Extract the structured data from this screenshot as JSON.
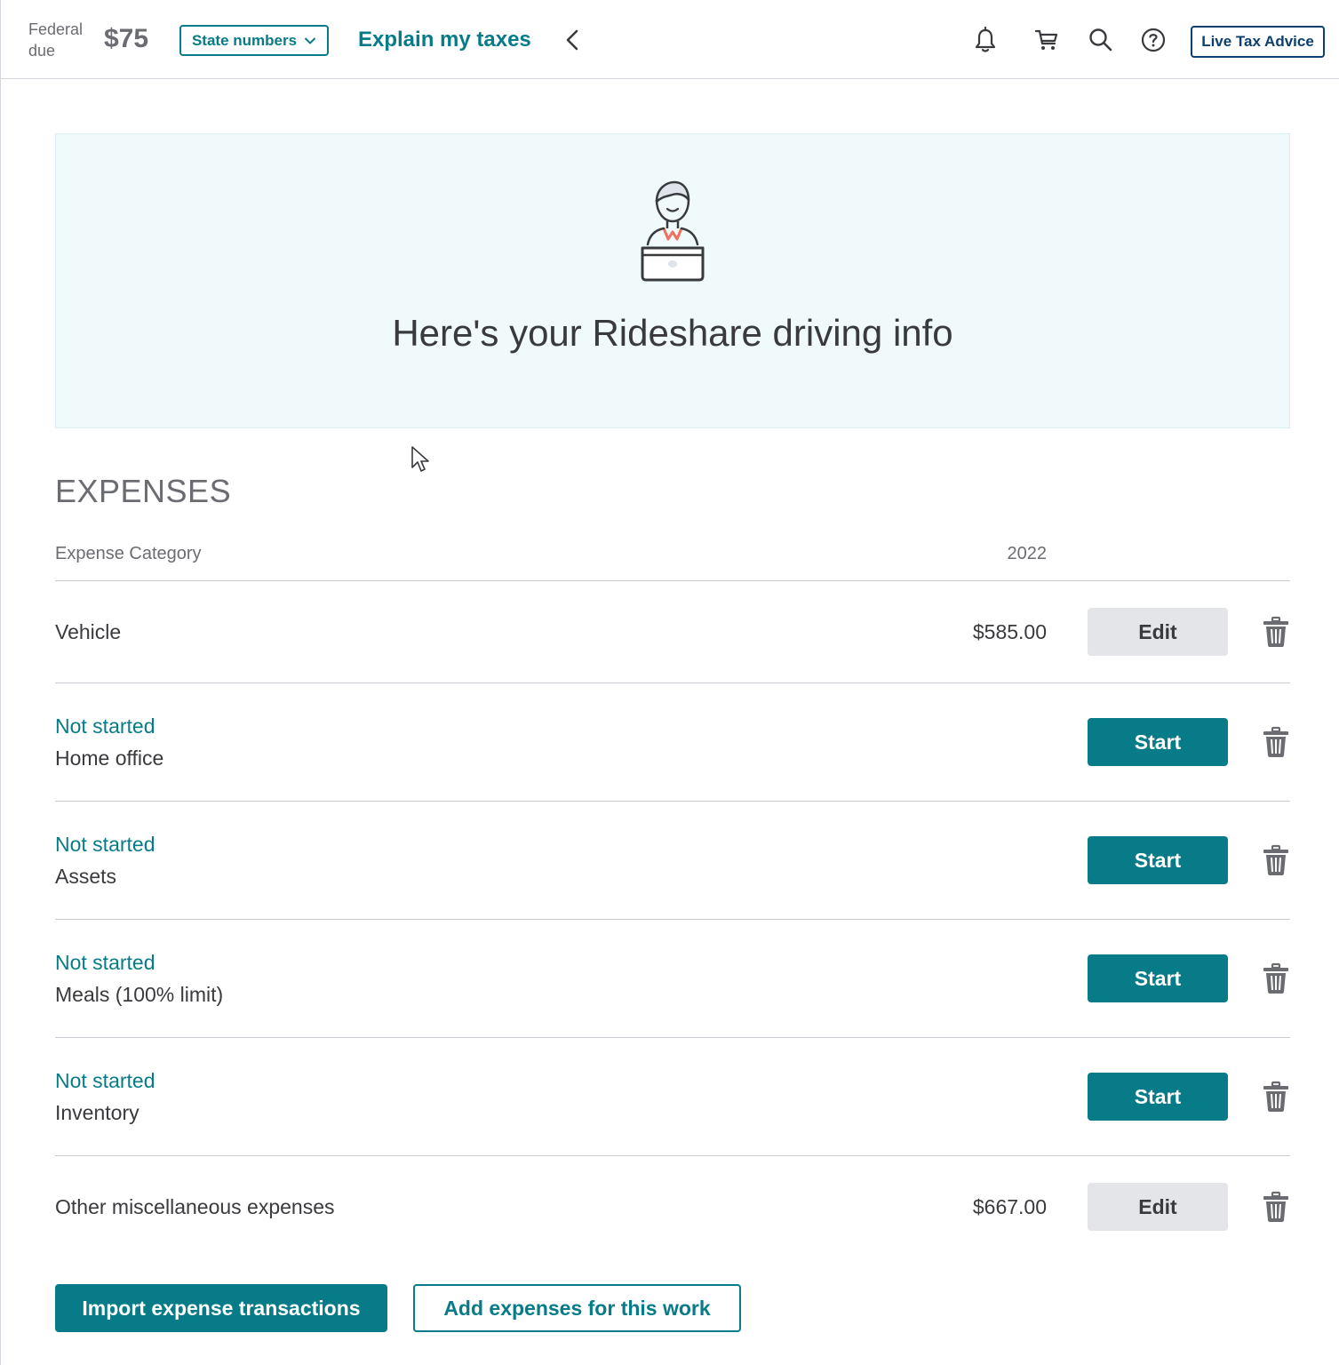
{
  "header": {
    "federal_label": "Federal due",
    "federal_amount": "$75",
    "state_numbers_label": "State numbers",
    "explain_label": "Explain my taxes",
    "live_advice_label": "Live Tax Advice",
    "icons": [
      "chevron-left-icon",
      "bell-icon",
      "cart-icon",
      "search-icon",
      "help-icon"
    ]
  },
  "banner": {
    "title": "Here's your Rideshare driving info",
    "illustration": "person-with-laptop-icon"
  },
  "expenses": {
    "section_title": "EXPENSES",
    "column_category": "Expense Category",
    "column_year": "2022",
    "rows": [
      {
        "status": "",
        "label": "Vehicle",
        "amount": "$585.00",
        "action": "Edit"
      },
      {
        "status": "Not started",
        "label": "Home office",
        "amount": "",
        "action": "Start"
      },
      {
        "status": "Not started",
        "label": "Assets",
        "amount": "",
        "action": "Start"
      },
      {
        "status": "Not started",
        "label": "Meals (100% limit)",
        "amount": "",
        "action": "Start"
      },
      {
        "status": "Not started",
        "label": "Inventory",
        "amount": "",
        "action": "Start"
      },
      {
        "status": "",
        "label": "Other miscellaneous expenses",
        "amount": "$667.00",
        "action": "Edit"
      }
    ]
  },
  "footer": {
    "import_label": "Import expense transactions",
    "add_label": "Add expenses for this work"
  },
  "colors": {
    "teal": "#077c88",
    "navy": "#0d3f6e",
    "banner_bg": "#f1fafb",
    "edit_bg": "#e4e5e8",
    "text": "#393a3d",
    "muted": "#6b6c72"
  }
}
